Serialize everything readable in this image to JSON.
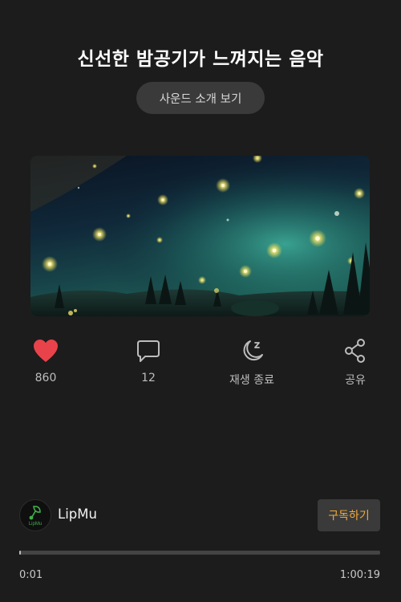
{
  "header": {
    "title": "신선한 밤공기가 느껴지는 음악",
    "intro_button": "사운드 소개 보기"
  },
  "artwork": {
    "description_icon": "night-forest-fireflies-image"
  },
  "actions": {
    "like_count": "860",
    "comment_count": "12",
    "sleep_label": "재생 종료",
    "share_label": "공유"
  },
  "channel": {
    "name": "LipMu",
    "subscribe_label": "구독하기",
    "logo_text": "LipMu"
  },
  "player": {
    "current_time": "0:01",
    "total_time": "1:00:19",
    "progress_fraction": 0.0003
  },
  "colors": {
    "background": "#1c1c1c",
    "like_red": "#e8434b",
    "subscribe_orange": "#f0a93b",
    "logo_green": "#3fae4b"
  }
}
